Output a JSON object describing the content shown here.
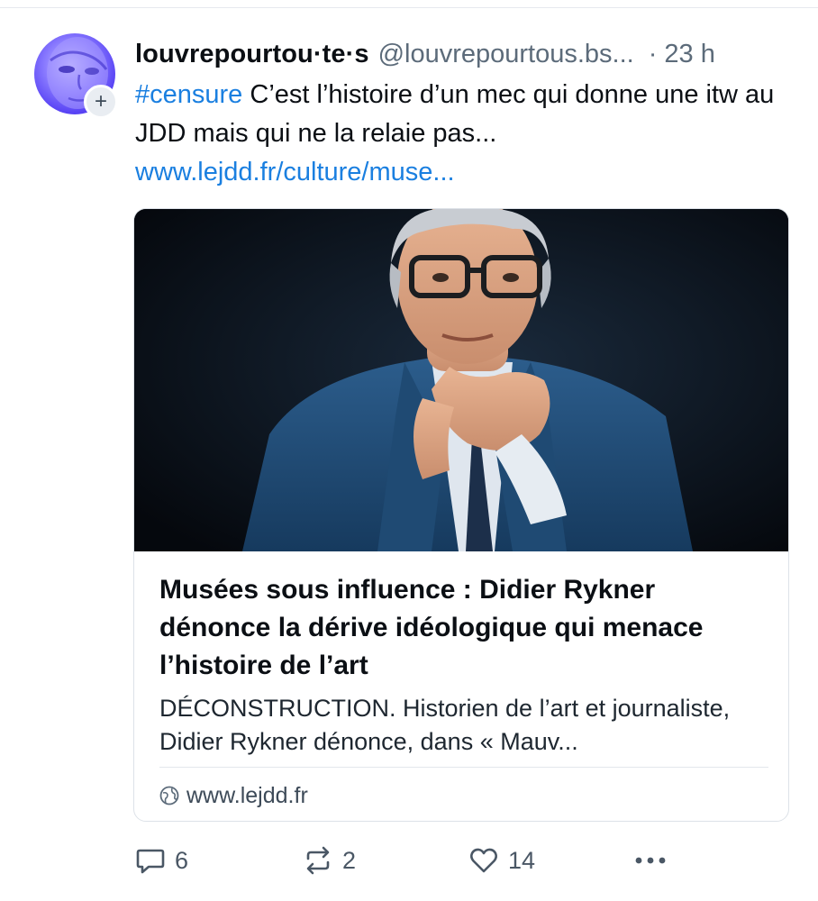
{
  "post": {
    "display_name": "louvrepourtou·te·s",
    "handle": "@louvrepourtous.bs...",
    "separator": "·",
    "time": "23 h",
    "follow_symbol": "+",
    "text": {
      "hashtag": "#censure",
      "body": " C’est l’histoire d’un mec qui donne une itw au JDD mais qui ne la relaie pas...",
      "link": "www.lejdd.fr/culture/muse..."
    }
  },
  "card": {
    "title": "Musées sous influence : Didier Rykner dénonce la dérive idéologique qui menace l’histoire de l’art",
    "description": "DÉCONSTRUCTION. Historien de l’art et journaliste, Didier Rykner dénonce, dans « Mauv...",
    "domain": "www.lejdd.fr"
  },
  "actions": {
    "replies": "6",
    "reposts": "2",
    "likes": "14"
  },
  "icons": {
    "reply": "reply-icon",
    "repost": "repost-icon",
    "like": "heart-icon",
    "more": "more-dots-icon",
    "globe": "globe-icon"
  },
  "colors": {
    "link": "#1a7fe0",
    "muted": "#5c6b7a",
    "avatar_accent": "#5a45f5"
  }
}
